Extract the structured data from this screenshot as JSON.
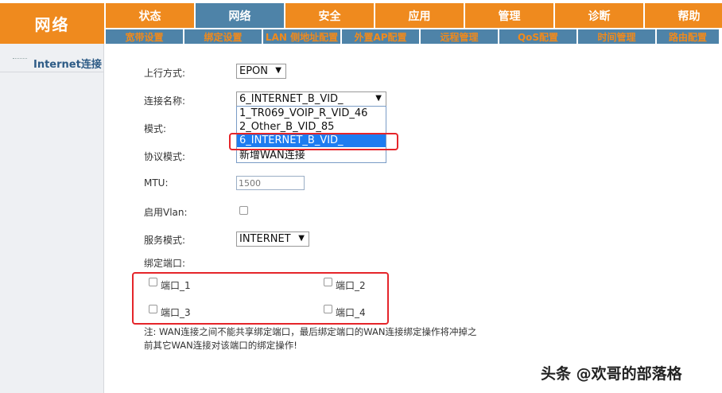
{
  "logo": "网络",
  "main_tabs": [
    "状态",
    "网络",
    "安全",
    "应用",
    "管理",
    "诊断",
    "帮助"
  ],
  "sub_tabs": [
    "宽带设置",
    "绑定设置",
    "LAN 侧地址配置",
    "外置AP配置",
    "远程管理",
    "QoS配置",
    "时间管理",
    "路由配置"
  ],
  "sidebar": {
    "item": "Internet连接"
  },
  "form": {
    "uplink_label": "上行方式:",
    "uplink_value": "EPON",
    "conn_name_label": "连接名称:",
    "conn_name_value": "6_INTERNET_B_VID_",
    "conn_options": [
      "1_TR069_VOIP_R_VID_46",
      "2_Other_B_VID_85",
      "6_INTERNET_B_VID_",
      "新增WAN连接"
    ],
    "mode_label": "模式:",
    "protocol_label": "协议模式:",
    "mtu_label": "MTU:",
    "mtu_value": "1500",
    "vlan_label": "启用Vlan:",
    "service_label": "服务模式:",
    "service_value": "INTERNET",
    "bind_label": "绑定端口:",
    "ports": [
      "端口_1",
      "端口_2",
      "端口_3",
      "端口_4"
    ],
    "note_line1": "注: WAN连接之间不能共享绑定端口，最后绑定端口的WAN连接绑定操作将冲掉之",
    "note_line2": "前其它WAN连接对该端口的绑定操作!"
  },
  "watermark": "头条 @欢哥的部落格",
  "colors": {
    "orange": "#ef8a1e",
    "blue": "#4e83a8",
    "highlight": "#1e7cf0",
    "annotation_red": "#e5252a"
  }
}
